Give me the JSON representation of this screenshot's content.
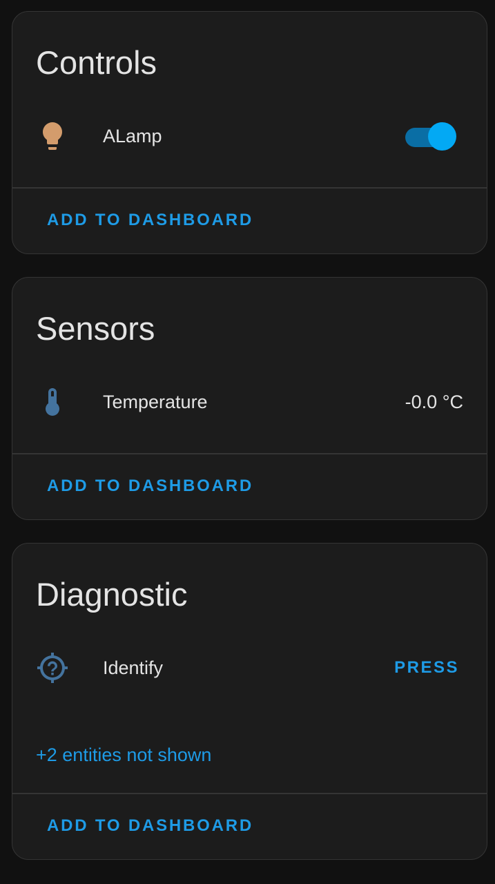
{
  "colors": {
    "background": "#111111",
    "card": "#1c1c1c",
    "border": "#353535",
    "accent": "#1e9be6",
    "toggle_on": "#03a9f4",
    "lamp_icon": "#d39c6c",
    "sensor_icon": "#44739e"
  },
  "cards": [
    {
      "title": "Controls",
      "entities": [
        {
          "icon": "lightbulb-icon",
          "name": "ALamp",
          "toggle_on": true
        }
      ],
      "action_label": "ADD TO DASHBOARD"
    },
    {
      "title": "Sensors",
      "entities": [
        {
          "icon": "thermometer-icon",
          "name": "Temperature",
          "state": "-0.0 °C"
        }
      ],
      "action_label": "ADD TO DASHBOARD"
    },
    {
      "title": "Diagnostic",
      "entities": [
        {
          "icon": "crosshairs-question-icon",
          "name": "Identify",
          "button_label": "PRESS"
        }
      ],
      "more_link": "+2 entities not shown",
      "action_label": "ADD TO DASHBOARD"
    }
  ]
}
